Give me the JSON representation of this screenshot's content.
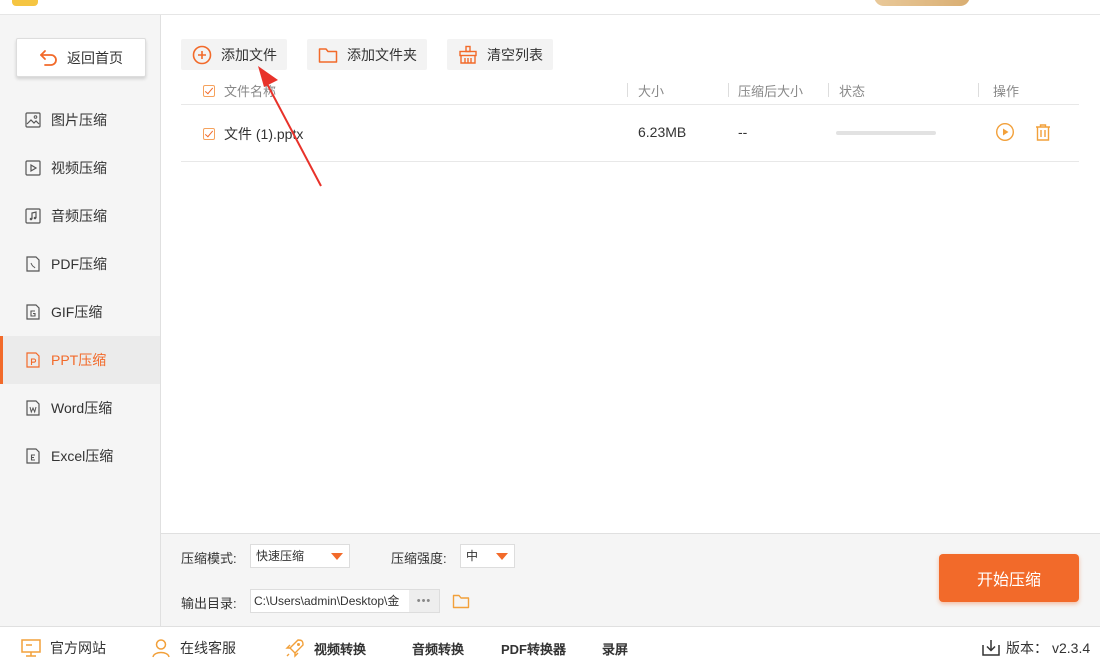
{
  "sidebar": {
    "back_label": "返回首页",
    "items": [
      {
        "label": "图片压缩",
        "icon": "image-icon"
      },
      {
        "label": "视频压缩",
        "icon": "video-icon"
      },
      {
        "label": "音频压缩",
        "icon": "audio-icon"
      },
      {
        "label": "PDF压缩",
        "icon": "pdf-icon"
      },
      {
        "label": "GIF压缩",
        "icon": "gif-icon"
      },
      {
        "label": "PPT压缩",
        "icon": "ppt-icon",
        "active": true
      },
      {
        "label": "Word压缩",
        "icon": "word-icon"
      },
      {
        "label": "Excel压缩",
        "icon": "excel-icon"
      }
    ]
  },
  "toolbar": {
    "add_file": "添加文件",
    "add_folder": "添加文件夹",
    "clear_list": "清空列表"
  },
  "table": {
    "headers": {
      "name": "文件名称",
      "size": "大小",
      "compressed_size": "压缩后大小",
      "status": "状态",
      "actions": "操作"
    },
    "rows": [
      {
        "name": "文件 (1).pptx",
        "size": "6.23MB",
        "compressed_size": "--",
        "progress": 0
      }
    ]
  },
  "settings": {
    "mode_label": "压缩模式:",
    "mode_value": "快速压缩",
    "strength_label": "压缩强度:",
    "strength_value": "中",
    "output_label": "输出目录:",
    "output_path": "C:\\Users\\admin\\Desktop\\金",
    "path_more": "•••",
    "start_label": "开始压缩"
  },
  "footer": {
    "website": "官方网站",
    "support": "在线客服",
    "video_convert": "视频转换",
    "audio_convert": "音频转换",
    "pdf_convert": "PDF转换器",
    "record": "录屏",
    "version_label": "版本：",
    "version": "v2.3.4"
  },
  "colors": {
    "accent": "#f26a2a",
    "sidebar_bg": "#f5f5f5",
    "toolbar_btn_bg": "#f3f3f3",
    "arrow": "#e8322a"
  }
}
